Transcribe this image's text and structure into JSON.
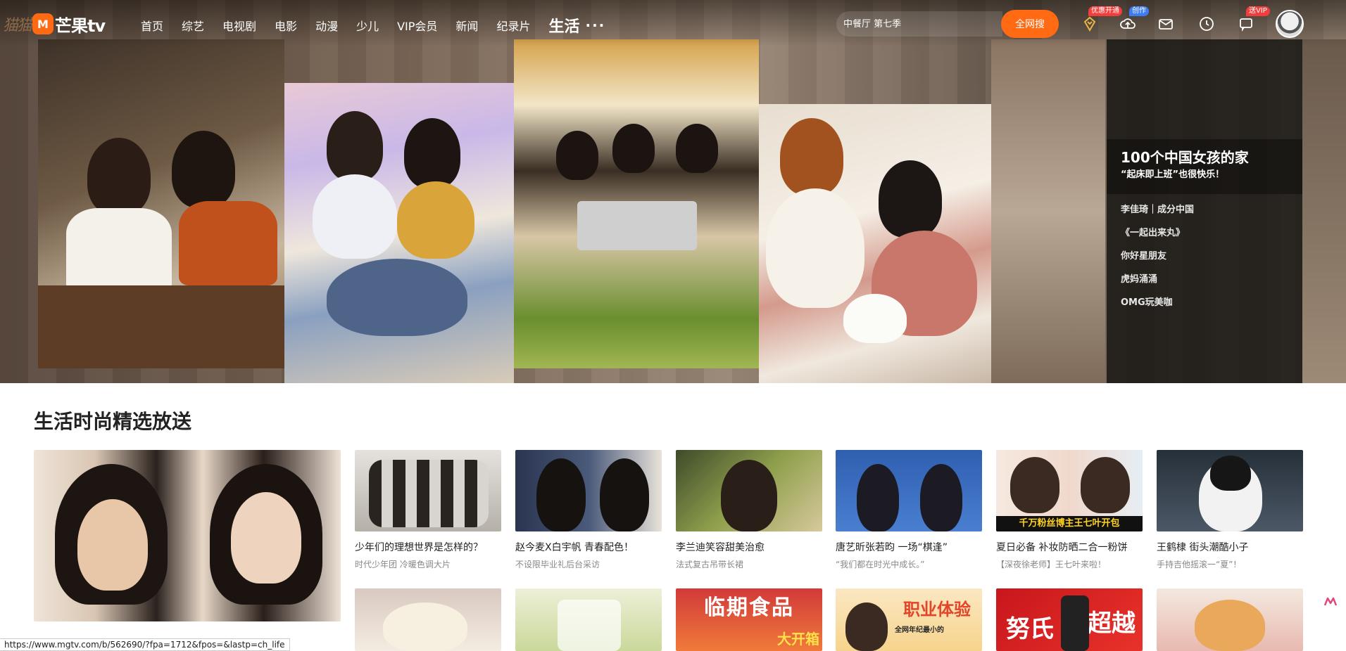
{
  "brand": {
    "script": "猫猫",
    "mark": "M",
    "name": "芒果tv"
  },
  "nav": {
    "items": [
      "首页",
      "综艺",
      "电视剧",
      "电影",
      "动漫",
      "少儿",
      "VIP会员",
      "新闻",
      "纪录片"
    ],
    "active": "生活",
    "more": "···"
  },
  "search": {
    "value": "",
    "placeholder": "中餐厅 第七季",
    "button": "全网搜"
  },
  "tools": {
    "vip_badge": "优惠开通",
    "create_badge": "创作",
    "msg_badge": "送VIP"
  },
  "hero": {
    "title": "100个中国女孩的家",
    "subtitle": "“起床即上班”也很快乐！",
    "list": [
      "李佳琦｜成分中国",
      "《一起出来丸》",
      "你好星朋友",
      "虎妈涌涌",
      "OMG玩美咖"
    ]
  },
  "section": {
    "title": "生活时尚精选放送"
  },
  "cards": [
    {
      "title": "少年们的理想世界是怎样的？",
      "sub": "时代少年团 冷暖色调大片"
    },
    {
      "title": "赵今麦X白宇帆 青春配色！",
      "sub": "不设限毕业礼后台采访"
    },
    {
      "title": "李兰迪笑容甜美治愈",
      "sub": "法式复古吊带长裙"
    },
    {
      "title": "唐艺昕张若昀 一场“棋逢”",
      "sub": "“我们都在时光中成长。”"
    },
    {
      "title": "夏日必备 补妆防晒二合一粉饼",
      "sub": "【深夜徐老师】王七叶来啦！"
    },
    {
      "title": "王鹤棣 街头潮酷小子",
      "sub": "手持吉他摇滚一“夏”！"
    }
  ],
  "thumb_text": {
    "c5": "千万粉丝博主王七叶开包",
    "r2c3": "临期食品",
    "r2c3b": "大开箱",
    "r2c4": "职业体验",
    "r2c4b": "全网年纪最小的",
    "r2c5": "努氏",
    "r2c5b": "超越"
  },
  "status_url": "https://www.mgtv.com/b/562690/?fpa=1712&fpos=&lastp=ch_life",
  "colors": {
    "accent": "#ff6a13",
    "panel": "#141210"
  }
}
